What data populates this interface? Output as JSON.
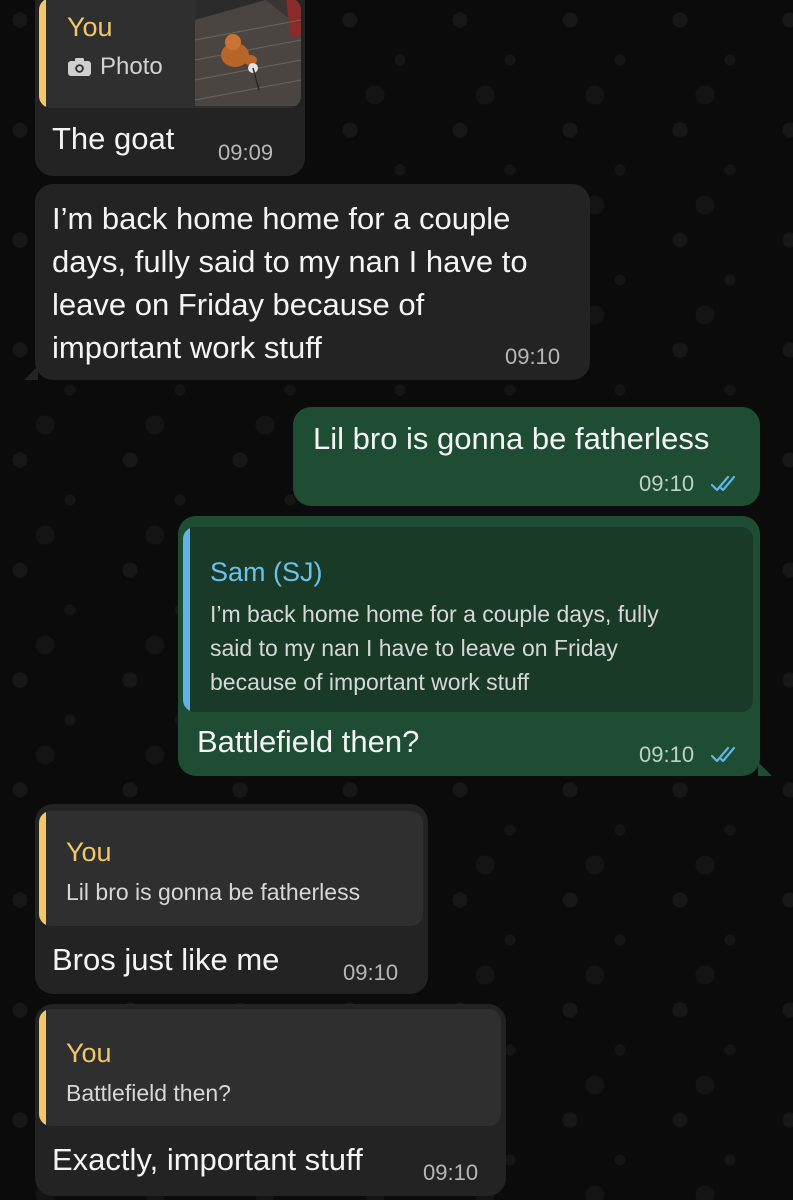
{
  "messages": [
    {
      "direction": "incoming",
      "quote": {
        "author": "You",
        "photo_label": "Photo",
        "camera_icon": "camera-icon"
      },
      "text": "The goat",
      "time": "09:09"
    },
    {
      "direction": "incoming",
      "lines": [
        "I’m back home home for a couple",
        "days, fully said to my nan I have to",
        "leave on Friday because of",
        "important work stuff"
      ],
      "time": "09:10"
    },
    {
      "direction": "outgoing",
      "text": "Lil bro is gonna be fatherless",
      "time": "09:10",
      "status": "read"
    },
    {
      "direction": "outgoing",
      "quote": {
        "author": "Sam (SJ)",
        "lines": [
          "I’m back home home for a couple days, fully",
          "said to my nan I have to leave on Friday",
          "because of important work stuff"
        ]
      },
      "text": "Battlefield then?",
      "time": "09:10",
      "status": "read"
    },
    {
      "direction": "incoming",
      "quote": {
        "author": "You",
        "text": "Lil bro is gonna be fatherless"
      },
      "text": "Bros just like me",
      "time": "09:10"
    },
    {
      "direction": "incoming",
      "quote": {
        "author": "You",
        "text": "Battlefield then?"
      },
      "text": "Exactly, important stuff",
      "time": "09:10"
    }
  ],
  "colors": {
    "incoming_bubble": "#232323",
    "outgoing_bubble": "#1e4d33",
    "you_accent": "#f1c76a",
    "sam_accent": "#6cc0ec",
    "read_ticks": "#5fb6e6"
  }
}
